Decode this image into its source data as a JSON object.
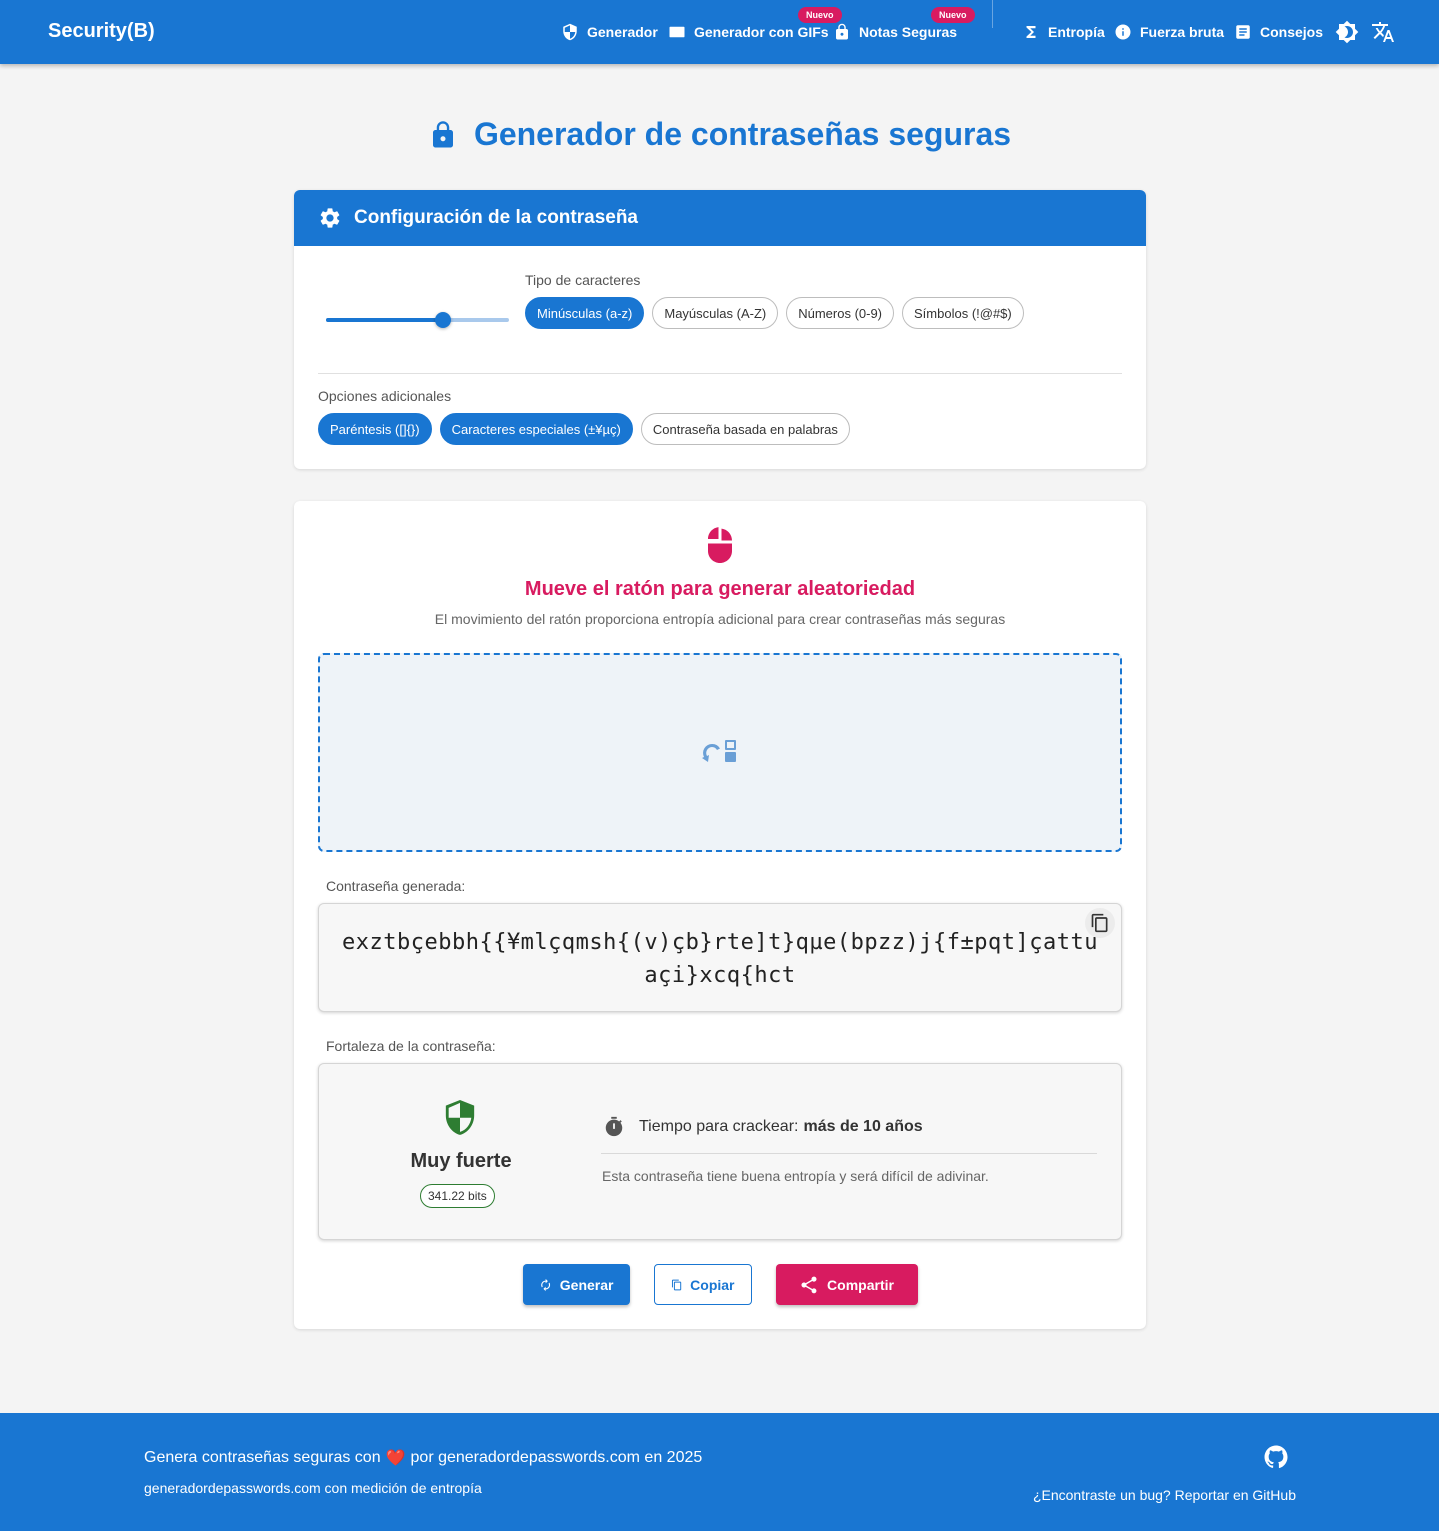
{
  "header": {
    "brand": "Security(B)",
    "nav": [
      {
        "label": "Generador",
        "icon": "shield-icon"
      },
      {
        "label": "Generador con GIFs",
        "icon": "gif-icon",
        "badge": "Nuevo"
      },
      {
        "label": "Notas Seguras",
        "icon": "lock-icon",
        "badge": "Nuevo"
      },
      {
        "label": "Entropía",
        "icon": "sigma-icon"
      },
      {
        "label": "Fuerza bruta",
        "icon": "info-icon"
      },
      {
        "label": "Consejos",
        "icon": "article-icon"
      }
    ],
    "theme_icon": "brightness-icon",
    "language_icon": "translate-icon"
  },
  "page_title": "Generador de contraseñas seguras",
  "config": {
    "title": "Configuración de la contraseña",
    "length_slider_fraction": 0.64,
    "char_types_label": "Tipo de caracteres",
    "char_types": [
      {
        "label": "Minúsculas (a-z)",
        "selected": true
      },
      {
        "label": "Mayúsculas (A-Z)",
        "selected": false
      },
      {
        "label": "Números (0-9)",
        "selected": false
      },
      {
        "label": "Símbolos (!@#$)",
        "selected": false
      }
    ],
    "extra_label": "Opciones adicionales",
    "extras": [
      {
        "label": "Paréntesis ([]{})",
        "selected": true
      },
      {
        "label": "Caracteres especiales (±¥µç)",
        "selected": true
      },
      {
        "label": "Contraseña basada en palabras",
        "selected": false
      }
    ]
  },
  "entropy": {
    "title": "Mueve el ratón para generar aleatoriedad",
    "subtitle": "El movimiento del ratón proporciona entropía adicional para crear contraseñas más seguras"
  },
  "password": {
    "label": "Contraseña generada:",
    "value": "exztbçebbh{{¥mlçqmsh{(v)çb}rte]t}qµe(bpzz)j{f±pqt]çattuaçi}xcq{hct"
  },
  "strength": {
    "label": "Fortaleza de la contraseña:",
    "level": "Muy fuerte",
    "bits": "341.22 bits",
    "crack_prefix": "Tiempo para crackear:",
    "crack_value": "más de 10 años",
    "description": "Esta contraseña tiene buena entropía y será difícil de adivinar."
  },
  "actions": {
    "generate": "Generar",
    "copy": "Copiar",
    "share": "Compartir"
  },
  "footer": {
    "main_prefix": "Genera contraseñas seguras con",
    "heart": "❤️",
    "main_suffix": "por generadordepasswords.com en 2025",
    "sub": "generadordepasswords.com con medición de entropía",
    "bug_link": "¿Encontraste un bug? Reportar en GitHub"
  },
  "colors": {
    "primary": "#1976d2",
    "accent": "#d81b60",
    "success": "#2e7d32",
    "background": "#f4f4f4"
  }
}
